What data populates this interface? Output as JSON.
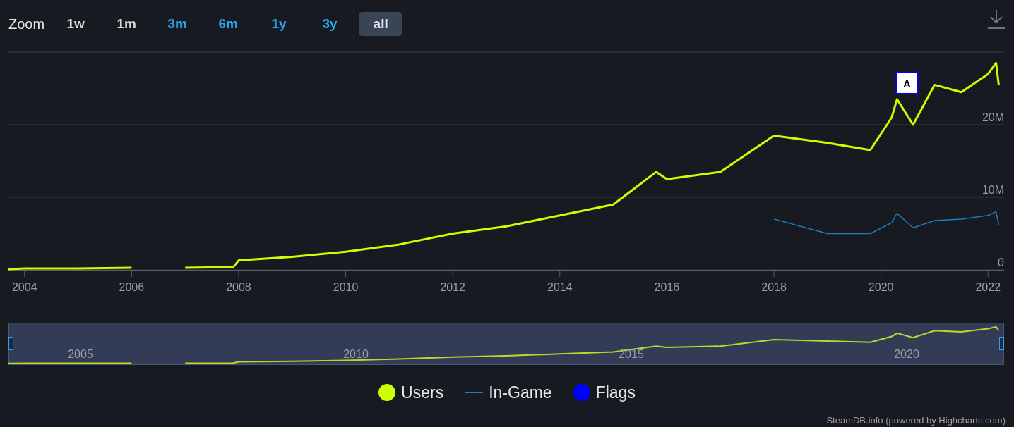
{
  "zoom": {
    "label": "Zoom",
    "buttons": [
      {
        "label": "1w",
        "selected": false,
        "disabled": true
      },
      {
        "label": "1m",
        "selected": false,
        "disabled": true
      },
      {
        "label": "3m",
        "selected": false,
        "disabled": false
      },
      {
        "label": "6m",
        "selected": false,
        "disabled": false
      },
      {
        "label": "1y",
        "selected": false,
        "disabled": false
      },
      {
        "label": "3y",
        "selected": false,
        "disabled": false
      },
      {
        "label": "all",
        "selected": true,
        "disabled": false
      }
    ]
  },
  "chart": {
    "chart_data": {
      "type": "line",
      "x": [
        2003.7,
        2004,
        2005,
        2006,
        2006.5,
        2007,
        2007.9,
        2008,
        2009,
        2010,
        2011,
        2012,
        2013,
        2014,
        2015,
        2015.8,
        2016,
        2017,
        2018,
        2019,
        2019.8,
        2020.2,
        2020.3,
        2020.6,
        2021,
        2021.5,
        2022,
        2022.15,
        2022.2
      ],
      "series": [
        {
          "name": "Users",
          "color": "#ccff00",
          "values": [
            0.1,
            0.2,
            0.2,
            0.3,
            null,
            0.3,
            0.4,
            1.3,
            1.8,
            2.5,
            3.5,
            5.0,
            6.0,
            7.5,
            9.0,
            13.5,
            12.5,
            13.5,
            18.5,
            17.5,
            16.5,
            21,
            23.5,
            20,
            25.5,
            24.5,
            27,
            28.5,
            25.5
          ]
        },
        {
          "name": "In-Game",
          "color": "#1c7dc4",
          "values": [
            null,
            null,
            null,
            null,
            null,
            null,
            null,
            null,
            null,
            null,
            null,
            null,
            null,
            null,
            null,
            null,
            null,
            null,
            7.0,
            5.0,
            5.0,
            6.5,
            7.8,
            5.8,
            6.8,
            7.0,
            7.5,
            8.0,
            6.2
          ]
        }
      ],
      "xlim": [
        2003.7,
        2022.3
      ],
      "ylim": [
        0,
        30
      ],
      "xticks": [
        2004,
        2006,
        2008,
        2010,
        2012,
        2014,
        2016,
        2018,
        2020,
        2022
      ],
      "yticks": [
        {
          "value": 0,
          "label": "0"
        },
        {
          "value": 10,
          "label": "10M"
        },
        {
          "value": 20,
          "label": "20M"
        }
      ],
      "annotations": [
        {
          "x": 2020.3,
          "y": 23.5,
          "text": "A"
        }
      ]
    },
    "flags_legend": {
      "label": "Flags",
      "color": "#0000ff"
    }
  },
  "navigator": {
    "labels": [
      "2005",
      "2010",
      "2015",
      "2020"
    ]
  },
  "legend": [
    {
      "kind": "dot"
    },
    {
      "kind": "line"
    },
    {
      "kind": "dot"
    }
  ],
  "credits": "SteamDB.info (powered by Highcharts.com)"
}
